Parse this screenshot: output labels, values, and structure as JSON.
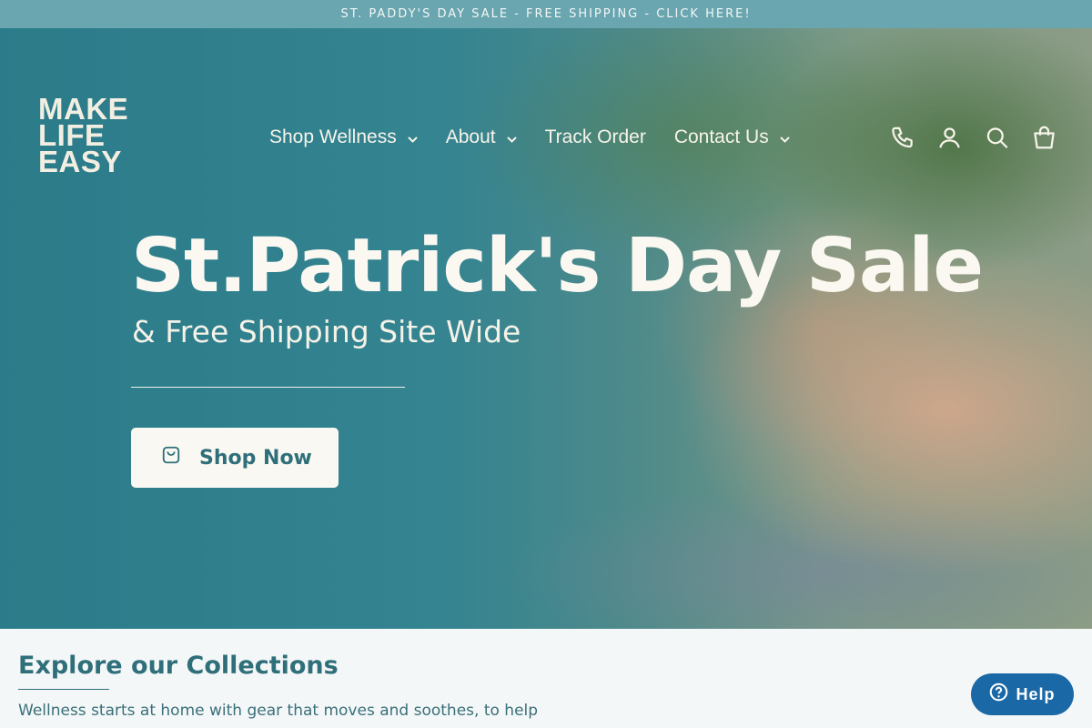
{
  "announcement": {
    "text": "ST. PADDY'S DAY SALE - FREE SHIPPING - CLICK HERE!"
  },
  "logo": {
    "lines": [
      "MAKE",
      "LIFE",
      "EASY"
    ]
  },
  "nav": {
    "items": [
      {
        "label": "Shop Wellness",
        "has_dropdown": true
      },
      {
        "label": "About",
        "has_dropdown": true
      },
      {
        "label": "Track Order",
        "has_dropdown": false
      },
      {
        "label": "Contact Us",
        "has_dropdown": true
      }
    ],
    "icons": [
      "phone-icon",
      "account-icon",
      "search-icon",
      "cart-icon"
    ]
  },
  "hero": {
    "headline": "St.Patrick's Day Sale",
    "subheadline": "& Free Shipping Site Wide",
    "cta_label": "Shop Now",
    "cta_icon": "shopping-bag-icon"
  },
  "collections": {
    "title": "Explore our Collections",
    "description": "Wellness starts at home with gear that moves and soothes, to help"
  },
  "help_button": {
    "label": "Help",
    "icon": "question-circle-icon"
  },
  "colors": {
    "announcement_bg": "#6aa6b0",
    "accent": "#2f6f7a",
    "help_bg": "#1b68a6"
  }
}
